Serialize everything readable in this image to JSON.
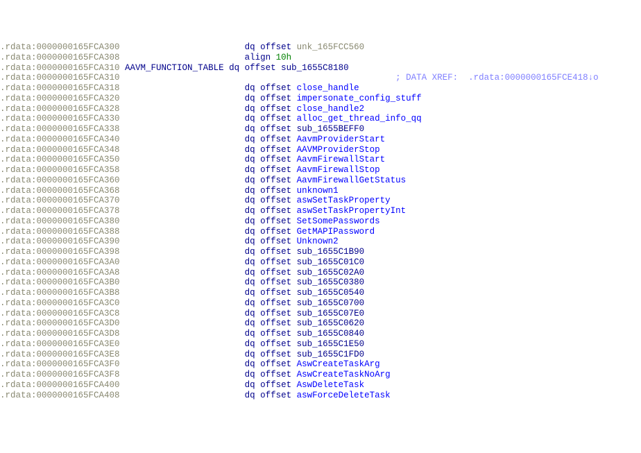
{
  "section": ".rdata",
  "xref_text": "; DATA XREF:  .rdata:0000000165FCE418↓o",
  "lines": [
    {
      "addr": "0000000165FCA300",
      "type": "dqoff",
      "target": "unk_165FCC560",
      "style": "unk"
    },
    {
      "addr": "0000000165FCA308",
      "type": "align",
      "value": "10h"
    },
    {
      "addr": "0000000165FCA310",
      "type": "symdef",
      "symbol": "AAVM_FUNCTION_TABLE",
      "target": "sub_1655C8180",
      "style": "sub",
      "has_xref": true
    },
    {
      "addr": "0000000165FCA318",
      "type": "dqoff",
      "target": "close_handle",
      "style": "func"
    },
    {
      "addr": "0000000165FCA320",
      "type": "dqoff",
      "target": "impersonate_config_stuff",
      "style": "func"
    },
    {
      "addr": "0000000165FCA328",
      "type": "dqoff",
      "target": "close_handle2",
      "style": "func"
    },
    {
      "addr": "0000000165FCA330",
      "type": "dqoff",
      "target": "alloc_get_thread_info_qq",
      "style": "func"
    },
    {
      "addr": "0000000165FCA338",
      "type": "dqoff",
      "target": "sub_1655BEFF0",
      "style": "sub"
    },
    {
      "addr": "0000000165FCA340",
      "type": "dqoff",
      "target": "AavmProviderStart",
      "style": "func"
    },
    {
      "addr": "0000000165FCA348",
      "type": "dqoff",
      "target": "AAVMProviderStop",
      "style": "func"
    },
    {
      "addr": "0000000165FCA350",
      "type": "dqoff",
      "target": "AavmFirewallStart",
      "style": "func"
    },
    {
      "addr": "0000000165FCA358",
      "type": "dqoff",
      "target": "AavmFirewallStop",
      "style": "func"
    },
    {
      "addr": "0000000165FCA360",
      "type": "dqoff",
      "target": "AavmFirewallGetStatus",
      "style": "func"
    },
    {
      "addr": "0000000165FCA368",
      "type": "dqoff",
      "target": "unknown1",
      "style": "func"
    },
    {
      "addr": "0000000165FCA370",
      "type": "dqoff",
      "target": "aswSetTaskProperty",
      "style": "func"
    },
    {
      "addr": "0000000165FCA378",
      "type": "dqoff",
      "target": "aswSetTaskPropertyInt",
      "style": "func"
    },
    {
      "addr": "0000000165FCA380",
      "type": "dqoff",
      "target": "SetSomePasswords",
      "style": "func"
    },
    {
      "addr": "0000000165FCA388",
      "type": "dqoff",
      "target": "GetMAPIPassword",
      "style": "func"
    },
    {
      "addr": "0000000165FCA390",
      "type": "dqoff",
      "target": "Unknown2",
      "style": "func"
    },
    {
      "addr": "0000000165FCA398",
      "type": "dqoff",
      "target": "sub_1655C1B90",
      "style": "sub"
    },
    {
      "addr": "0000000165FCA3A0",
      "type": "dqoff",
      "target": "sub_1655C01C0",
      "style": "sub"
    },
    {
      "addr": "0000000165FCA3A8",
      "type": "dqoff",
      "target": "sub_1655C02A0",
      "style": "sub"
    },
    {
      "addr": "0000000165FCA3B0",
      "type": "dqoff",
      "target": "sub_1655C0380",
      "style": "sub"
    },
    {
      "addr": "0000000165FCA3B8",
      "type": "dqoff",
      "target": "sub_1655C0540",
      "style": "sub"
    },
    {
      "addr": "0000000165FCA3C0",
      "type": "dqoff",
      "target": "sub_1655C0700",
      "style": "sub"
    },
    {
      "addr": "0000000165FCA3C8",
      "type": "dqoff",
      "target": "sub_1655C07E0",
      "style": "sub"
    },
    {
      "addr": "0000000165FCA3D0",
      "type": "dqoff",
      "target": "sub_1655C0620",
      "style": "sub"
    },
    {
      "addr": "0000000165FCA3D8",
      "type": "dqoff",
      "target": "sub_1655C0840",
      "style": "sub"
    },
    {
      "addr": "0000000165FCA3E0",
      "type": "dqoff",
      "target": "sub_1655C1E50",
      "style": "sub"
    },
    {
      "addr": "0000000165FCA3E8",
      "type": "dqoff",
      "target": "sub_1655C1FD0",
      "style": "sub"
    },
    {
      "addr": "0000000165FCA3F0",
      "type": "dqoff",
      "target": "AswCreateTaskArg",
      "style": "func"
    },
    {
      "addr": "0000000165FCA3F8",
      "type": "dqoff",
      "target": "AswCreateTaskNoArg",
      "style": "func"
    },
    {
      "addr": "0000000165FCA400",
      "type": "dqoff",
      "target": "AswDeleteTask",
      "style": "func"
    },
    {
      "addr": "0000000165FCA408",
      "type": "dqoff",
      "target": "aswForceDeleteTask",
      "style": "func"
    }
  ]
}
